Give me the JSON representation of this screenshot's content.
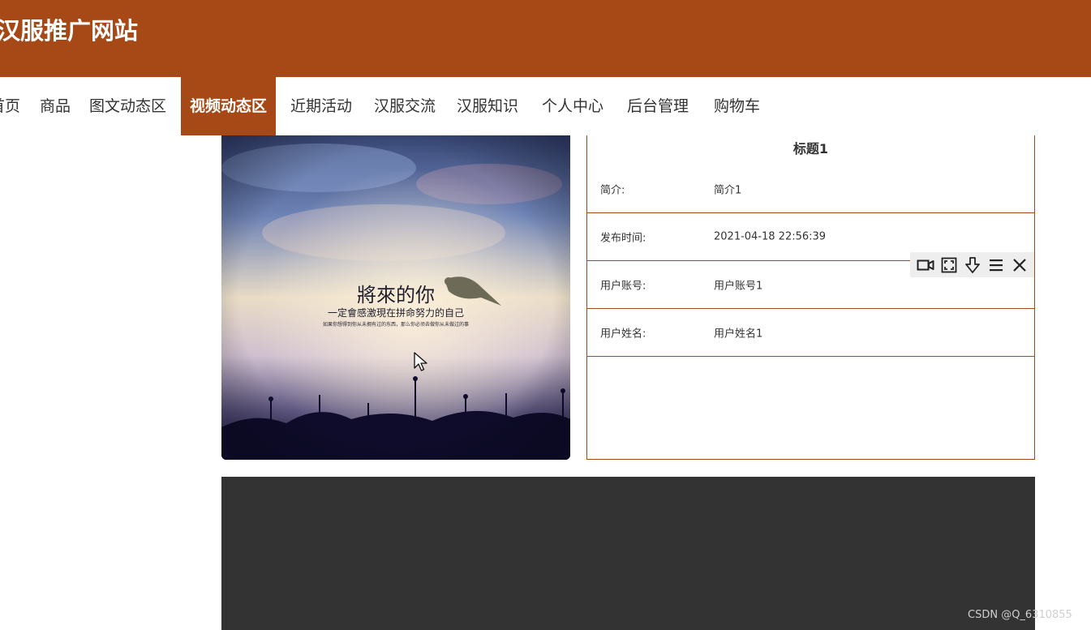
{
  "header": {
    "site_title": "汉服推广网站",
    "bg_color": "#a64917"
  },
  "nav": {
    "items": [
      {
        "label": "首页"
      },
      {
        "label": "商品"
      },
      {
        "label": "图文动态区"
      },
      {
        "label": "视频动态区",
        "active": true
      },
      {
        "label": "近期活动"
      },
      {
        "label": "汉服交流"
      },
      {
        "label": "汉服知识"
      },
      {
        "label": "个人中心"
      },
      {
        "label": "后台管理"
      },
      {
        "label": "购物车"
      }
    ]
  },
  "cover_image": {
    "caption_title": "將來的你",
    "caption_line1": "一定會感激現在拼命努力的自己",
    "caption_line2": "如果你想得到你从未拥有过的东西，那么你必须去做你从未做过的事"
  },
  "detail": {
    "title": "标题1",
    "fields": [
      {
        "label": "简介:",
        "value": "简介1"
      },
      {
        "label": "发布时间:",
        "value": "2021-04-18 22:56:39"
      },
      {
        "label": "用户账号:",
        "value": "用户账号1"
      },
      {
        "label": "用户姓名:",
        "value": "用户姓名1"
      }
    ]
  },
  "video_toolbar": {
    "icons": [
      "video-camera-icon",
      "fullscreen-icon",
      "download-icon",
      "menu-icon",
      "close-icon"
    ]
  },
  "watermark": "CSDN @Q_6310855",
  "colors": {
    "accent": "#a64917",
    "player_bg": "#333333"
  }
}
